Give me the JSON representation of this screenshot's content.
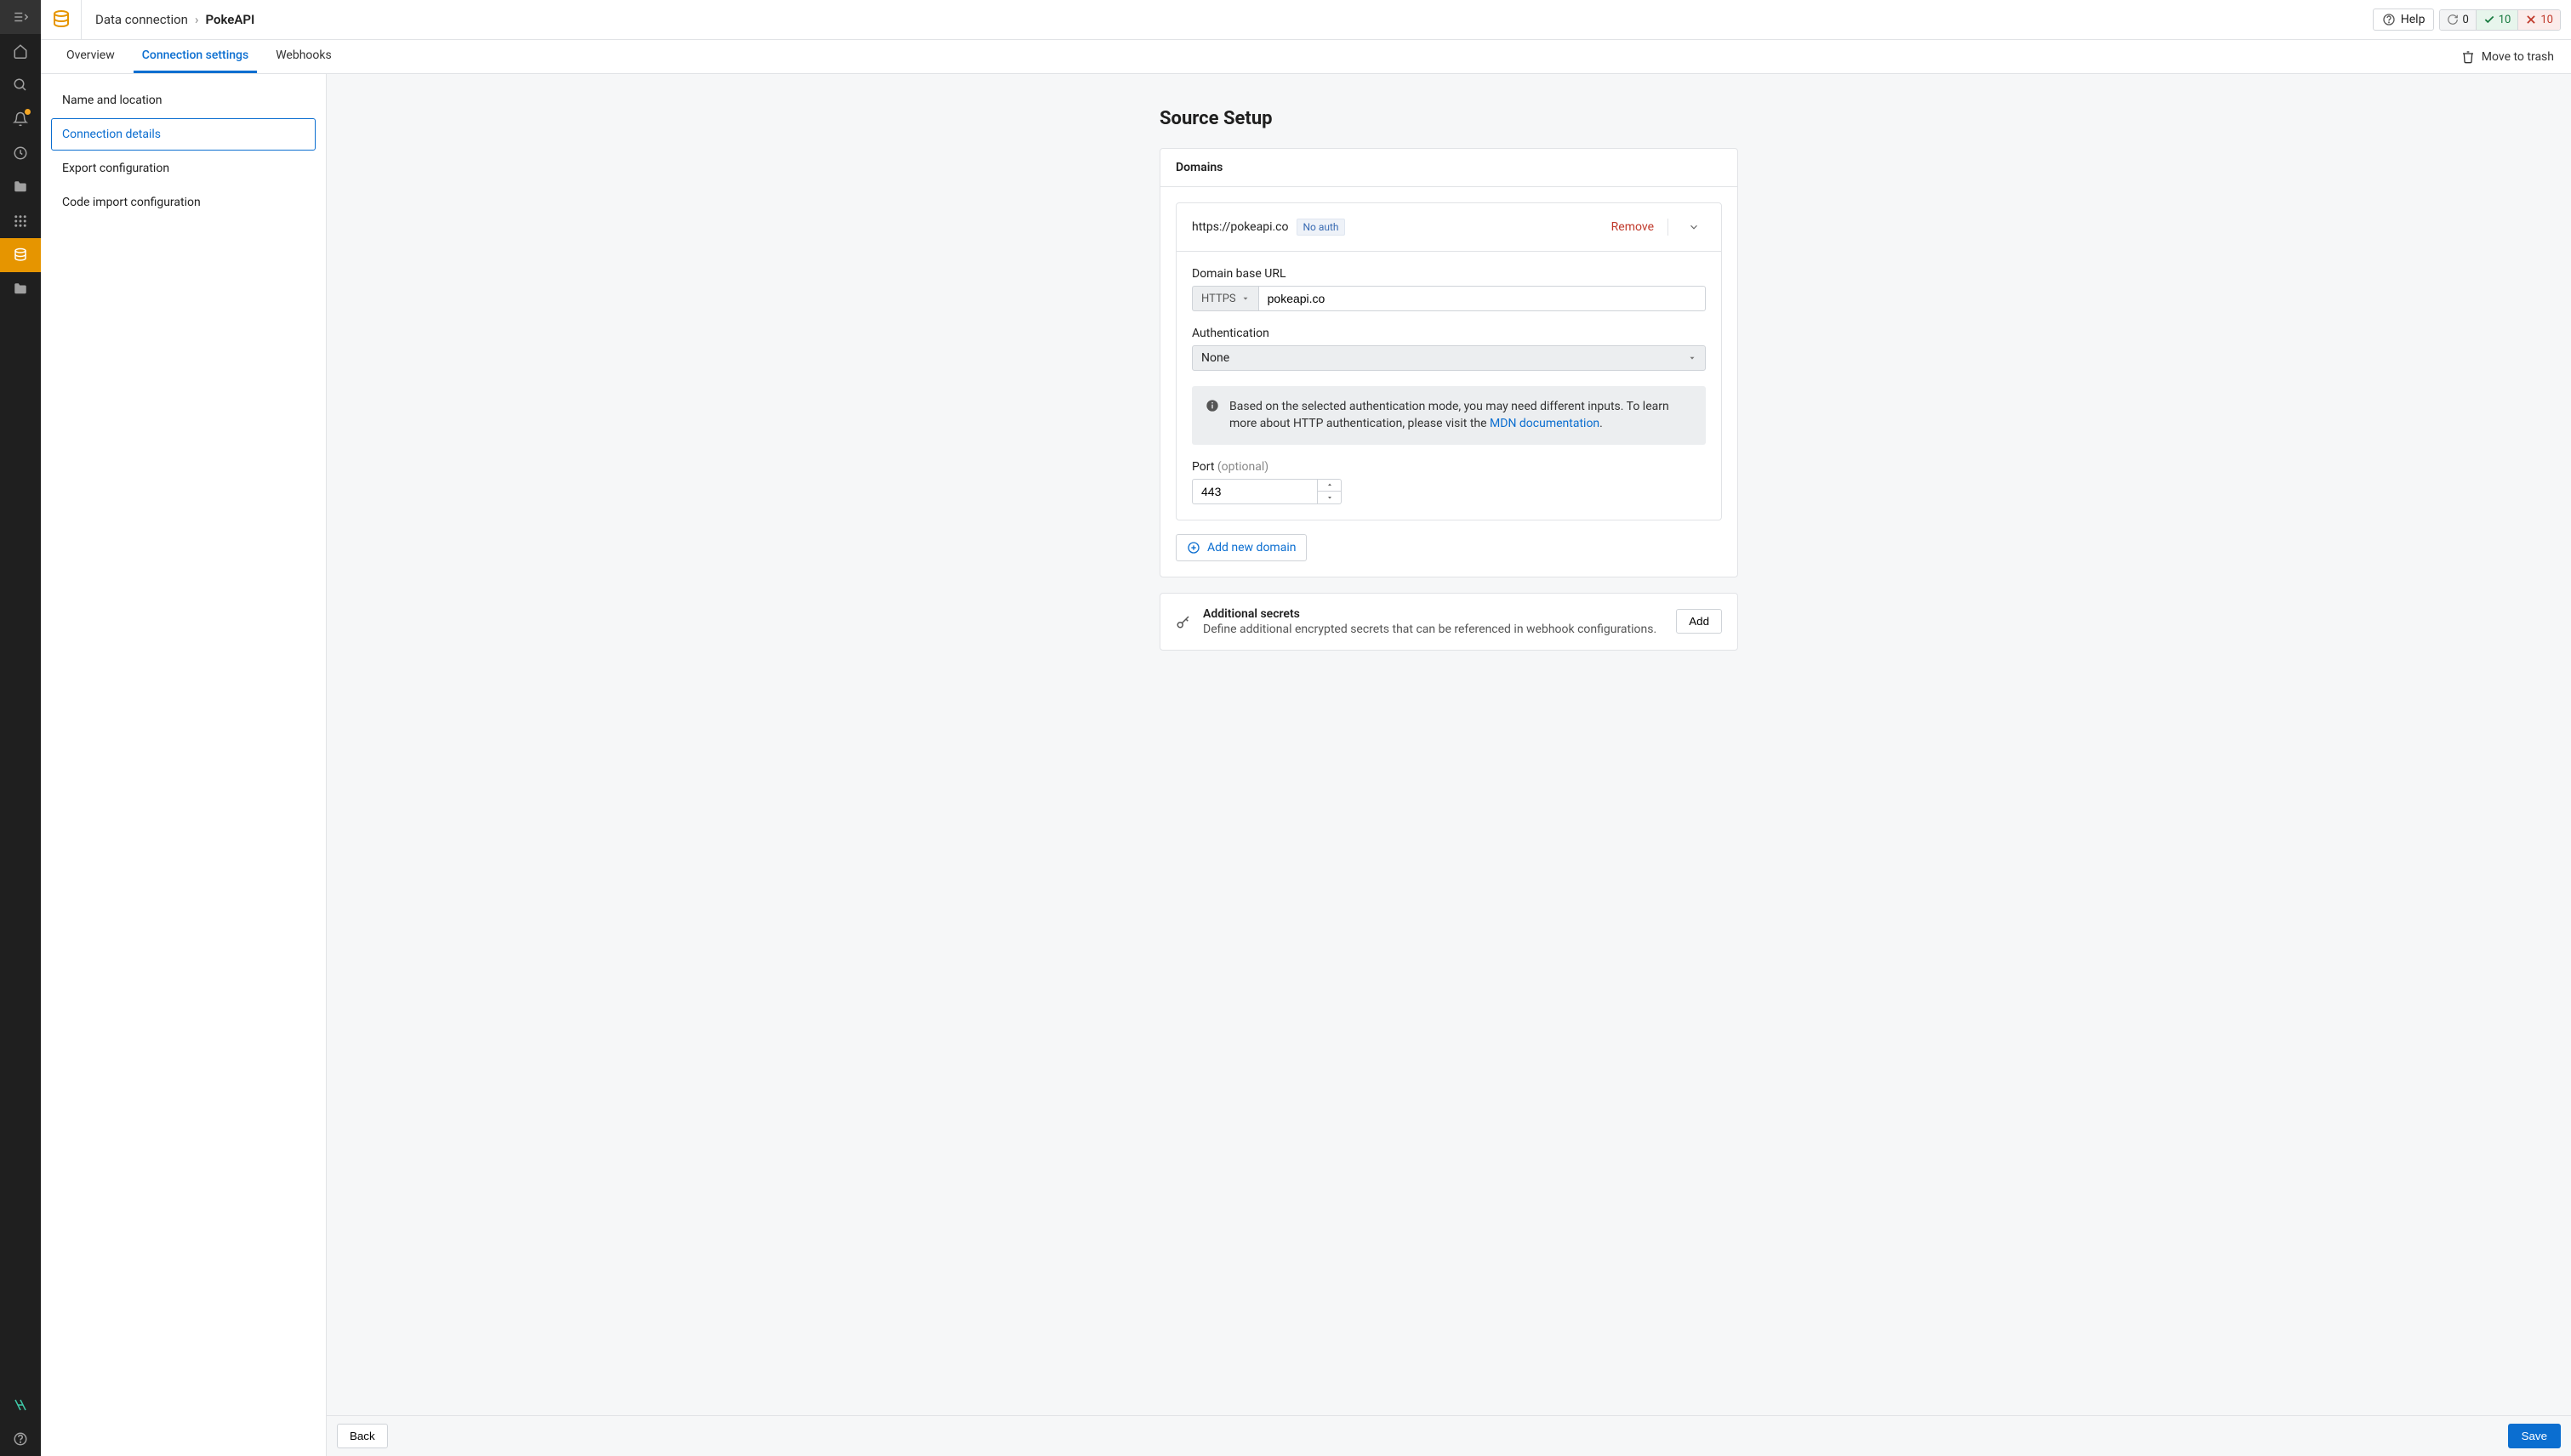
{
  "breadcrumb": {
    "parent": "Data connection",
    "current": "PokeAPI"
  },
  "header": {
    "help": "Help",
    "status_sync": "0",
    "status_ok": "10",
    "status_err": "10"
  },
  "tabs": {
    "overview": "Overview",
    "connection_settings": "Connection settings",
    "webhooks": "Webhooks",
    "move_to_trash": "Move to trash"
  },
  "sidenav": {
    "name_location": "Name and location",
    "connection_details": "Connection details",
    "export_config": "Export configuration",
    "code_import": "Code import configuration"
  },
  "page": {
    "title": "Source Setup",
    "domains_header": "Domains",
    "domain": {
      "url": "https://pokeapi.co",
      "badge": "No auth",
      "remove": "Remove",
      "base_url_label": "Domain base URL",
      "protocol": "HTTPS",
      "base_url_value": "pokeapi.co",
      "auth_label": "Authentication",
      "auth_value": "None",
      "info_text_1": "Based on the selected authentication mode, you may need different inputs. To learn more about HTTP authentication, please visit the ",
      "info_link": "MDN documentation",
      "info_text_2": ".",
      "port_label": "Port",
      "port_optional": " (optional)",
      "port_value": "443"
    },
    "add_domain": "Add new domain",
    "secrets": {
      "title": "Additional secrets",
      "desc": "Define additional encrypted secrets that can be referenced in webhook configurations.",
      "add": "Add"
    }
  },
  "footer": {
    "back": "Back",
    "save": "Save"
  }
}
